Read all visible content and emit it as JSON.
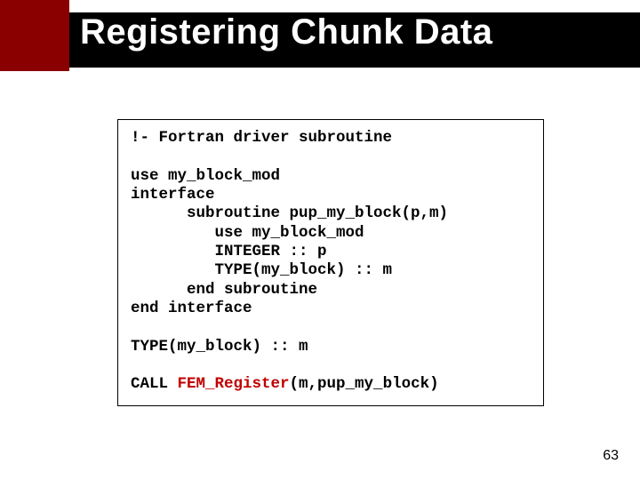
{
  "title": "Registering Chunk Data",
  "code": {
    "l1": "!- Fortran driver subroutine",
    "blank1": "",
    "l2": "use my_block_mod",
    "l3": "interface",
    "l4": "      subroutine pup_my_block(p,m)",
    "l5": "         use my_block_mod",
    "l6": "         INTEGER :: p",
    "l7": "         TYPE(my_block) :: m",
    "l8": "      end subroutine",
    "l9": "end interface",
    "blank2": "",
    "l10": "TYPE(my_block) :: m",
    "blank3": "",
    "call_pre": "CALL ",
    "call_fn": "FEM_Register",
    "call_post": "(m,pup_my_block)"
  },
  "pagenum": "63"
}
